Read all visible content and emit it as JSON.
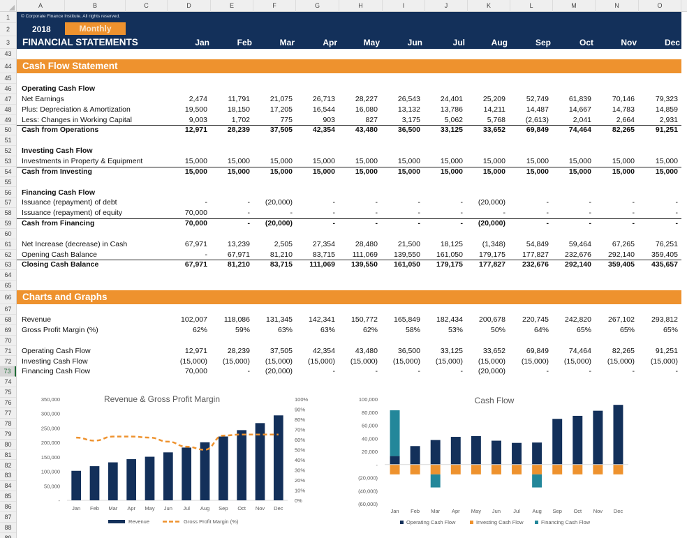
{
  "sheet": {
    "columns": [
      "A",
      "B",
      "C",
      "D",
      "E",
      "F",
      "G",
      "H",
      "I",
      "J",
      "K",
      "L",
      "M",
      "N",
      "O"
    ],
    "rows": [
      1,
      2,
      3,
      43,
      44,
      45,
      46,
      47,
      48,
      49,
      50,
      51,
      52,
      53,
      54,
      55,
      56,
      57,
      58,
      59,
      60,
      61,
      62,
      63,
      64,
      65,
      66,
      67,
      68,
      69,
      70,
      71,
      72,
      73,
      74,
      75,
      76,
      77,
      78,
      79,
      80,
      81,
      82,
      83,
      84,
      85,
      86,
      87,
      88,
      89
    ],
    "selected_row": 73
  },
  "header": {
    "copyright": "© Corporate Finance Institute. All rights reserved.",
    "year": "2018",
    "period": "Monthly",
    "title": "FINANCIAL STATEMENTS",
    "months": [
      "Jan",
      "Feb",
      "Mar",
      "Apr",
      "May",
      "Jun",
      "Jul",
      "Aug",
      "Sep",
      "Oct",
      "Nov",
      "Dec"
    ]
  },
  "cash_flow": {
    "section_title": "Cash Flow Statement",
    "rows": [
      {
        "row": 46,
        "label": "Operating Cash Flow",
        "bold": true,
        "values": []
      },
      {
        "row": 47,
        "label": "Net Earnings",
        "values": [
          "2,474",
          "11,791",
          "21,075",
          "26,713",
          "28,227",
          "26,543",
          "24,401",
          "25,209",
          "52,749",
          "61,839",
          "70,146",
          "79,323"
        ]
      },
      {
        "row": 48,
        "label": "Plus: Depreciation & Amortization",
        "values": [
          "19,500",
          "18,150",
          "17,205",
          "16,544",
          "16,080",
          "13,132",
          "13,786",
          "14,211",
          "14,487",
          "14,667",
          "14,783",
          "14,859"
        ]
      },
      {
        "row": 49,
        "label": "Less: Changes in Working Capital",
        "values": [
          "9,003",
          "1,702",
          "775",
          "903",
          "827",
          "3,175",
          "5,062",
          "5,768",
          "(2,613)",
          "2,041",
          "2,664",
          "2,931"
        ]
      },
      {
        "row": 50,
        "label": "Cash from Operations",
        "bold": true,
        "rule": true,
        "values": [
          "12,971",
          "28,239",
          "37,505",
          "42,354",
          "43,480",
          "36,500",
          "33,125",
          "33,652",
          "69,849",
          "74,464",
          "82,265",
          "91,251"
        ]
      },
      {
        "row": 52,
        "label": "Investing Cash Flow",
        "bold": true,
        "values": []
      },
      {
        "row": 53,
        "label": "Investments in Property & Equipment",
        "values": [
          "15,000",
          "15,000",
          "15,000",
          "15,000",
          "15,000",
          "15,000",
          "15,000",
          "15,000",
          "15,000",
          "15,000",
          "15,000",
          "15,000"
        ]
      },
      {
        "row": 54,
        "label": "Cash from Investing",
        "bold": true,
        "rule": true,
        "values": [
          "15,000",
          "15,000",
          "15,000",
          "15,000",
          "15,000",
          "15,000",
          "15,000",
          "15,000",
          "15,000",
          "15,000",
          "15,000",
          "15,000"
        ]
      },
      {
        "row": 56,
        "label": "Financing Cash Flow",
        "bold": true,
        "values": []
      },
      {
        "row": 57,
        "label": "Issuance (repayment) of debt",
        "values": [
          "-",
          "-",
          "(20,000)",
          "-",
          "-",
          "-",
          "-",
          "(20,000)",
          "-",
          "-",
          "-",
          "-"
        ]
      },
      {
        "row": 58,
        "label": "Issuance (repayment) of equity",
        "values": [
          "70,000",
          "-",
          "-",
          "-",
          "-",
          "-",
          "-",
          "-",
          "-",
          "-",
          "-",
          "-"
        ]
      },
      {
        "row": 59,
        "label": "Cash from Financing",
        "bold": true,
        "rule": true,
        "values": [
          "70,000",
          "-",
          "(20,000)",
          "-",
          "-",
          "-",
          "-",
          "(20,000)",
          "-",
          "-",
          "-",
          "-"
        ]
      },
      {
        "row": 61,
        "label": "Net Increase (decrease) in Cash",
        "values": [
          "67,971",
          "13,239",
          "2,505",
          "27,354",
          "28,480",
          "21,500",
          "18,125",
          "(1,348)",
          "54,849",
          "59,464",
          "67,265",
          "76,251"
        ]
      },
      {
        "row": 62,
        "label": "Opening Cash Balance",
        "values": [
          "-",
          "67,971",
          "81,210",
          "83,715",
          "111,069",
          "139,550",
          "161,050",
          "179,175",
          "177,827",
          "232,676",
          "292,140",
          "359,405"
        ]
      },
      {
        "row": 63,
        "label": "Closing Cash Balance",
        "bold": true,
        "rule": true,
        "values": [
          "67,971",
          "81,210",
          "83,715",
          "111,069",
          "139,550",
          "161,050",
          "179,175",
          "177,827",
          "232,676",
          "292,140",
          "359,405",
          "435,657"
        ]
      }
    ]
  },
  "charts_section": {
    "section_title": "Charts and Graphs",
    "rows": [
      {
        "row": 68,
        "label": "Revenue",
        "values": [
          "102,007",
          "118,086",
          "131,345",
          "142,341",
          "150,772",
          "165,849",
          "182,434",
          "200,678",
          "220,745",
          "242,820",
          "267,102",
          "293,812"
        ]
      },
      {
        "row": 69,
        "label": "Gross Profit Margin (%)",
        "values": [
          "62%",
          "59%",
          "63%",
          "63%",
          "62%",
          "58%",
          "53%",
          "50%",
          "64%",
          "65%",
          "65%",
          "65%"
        ]
      },
      {
        "row": 71,
        "label": "Operating Cash Flow",
        "values": [
          "12,971",
          "28,239",
          "37,505",
          "42,354",
          "43,480",
          "36,500",
          "33,125",
          "33,652",
          "69,849",
          "74,464",
          "82,265",
          "91,251"
        ]
      },
      {
        "row": 72,
        "label": "Investing Cash Flow",
        "values": [
          "(15,000)",
          "(15,000)",
          "(15,000)",
          "(15,000)",
          "(15,000)",
          "(15,000)",
          "(15,000)",
          "(15,000)",
          "(15,000)",
          "(15,000)",
          "(15,000)",
          "(15,000)"
        ]
      },
      {
        "row": 73,
        "label": "Financing Cash Flow",
        "values": [
          "70,000",
          "-",
          "(20,000)",
          "-",
          "-",
          "-",
          "-",
          "(20,000)",
          "-",
          "-",
          "-",
          "-"
        ]
      }
    ]
  },
  "colors": {
    "navy": "#13305a",
    "orange": "#ee922e",
    "teal": "#23879a",
    "axis_text": "#595959"
  },
  "chart_data": [
    {
      "type": "bar",
      "title": "Revenue & Gross Profit Margin",
      "categories": [
        "Jan",
        "Feb",
        "Mar",
        "Apr",
        "May",
        "Jun",
        "Jul",
        "Aug",
        "Sep",
        "Oct",
        "Nov",
        "Dec"
      ],
      "series": [
        {
          "name": "Revenue",
          "kind": "bar",
          "axis": "left",
          "values": [
            102007,
            118086,
            131345,
            142341,
            150772,
            165849,
            182434,
            200678,
            220745,
            242820,
            267102,
            293812
          ]
        },
        {
          "name": "Gross Profit Margin (%)",
          "kind": "line-dashed",
          "axis": "right",
          "values": [
            62,
            59,
            63,
            63,
            62,
            58,
            53,
            50,
            64,
            65,
            65,
            65
          ]
        }
      ],
      "ylim": [
        0,
        350000
      ],
      "yticks": [
        "-",
        "50,000",
        "100,000",
        "150,000",
        "200,000",
        "250,000",
        "300,000",
        "350,000"
      ],
      "y2lim": [
        0,
        100
      ],
      "y2ticks": [
        "0%",
        "10%",
        "20%",
        "30%",
        "40%",
        "50%",
        "60%",
        "70%",
        "80%",
        "90%",
        "100%"
      ],
      "legend": "bottom",
      "grid": false
    },
    {
      "type": "bar",
      "stacked": true,
      "title": "Cash Flow",
      "categories": [
        "Jan",
        "Feb",
        "Mar",
        "Apr",
        "May",
        "Jun",
        "Jul",
        "Aug",
        "Sep",
        "Oct",
        "Nov",
        "Dec"
      ],
      "series": [
        {
          "name": "Operating Cash Flow",
          "values": [
            12971,
            28239,
            37505,
            42354,
            43480,
            36500,
            33125,
            33652,
            69849,
            74464,
            82265,
            91251
          ]
        },
        {
          "name": "Investing Cash Flow",
          "values": [
            -15000,
            -15000,
            -15000,
            -15000,
            -15000,
            -15000,
            -15000,
            -15000,
            -15000,
            -15000,
            -15000,
            -15000
          ]
        },
        {
          "name": "Financing Cash Flow",
          "values": [
            70000,
            0,
            -20000,
            0,
            0,
            0,
            0,
            -20000,
            0,
            0,
            0,
            0
          ]
        }
      ],
      "ylim": [
        -60000,
        100000
      ],
      "yticks": [
        "(60,000)",
        "(40,000)",
        "(20,000)",
        "-",
        "20,000",
        "40,000",
        "60,000",
        "80,000",
        "100,000"
      ],
      "legend": "bottom",
      "grid": false
    }
  ]
}
